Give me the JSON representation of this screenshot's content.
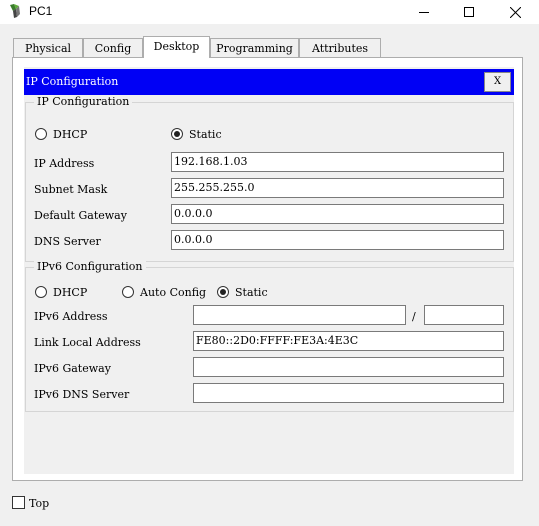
{
  "window": {
    "title": "PC1"
  },
  "tabs": [
    {
      "label": "Physical"
    },
    {
      "label": "Config"
    },
    {
      "label": "Desktop",
      "active": true
    },
    {
      "label": "Programming"
    },
    {
      "label": "Attributes"
    }
  ],
  "ip_config": {
    "header_title": "IP Configuration",
    "close_label": "X",
    "ipv4": {
      "legend": "IP Configuration",
      "dhcp_label": "DHCP",
      "static_label": "Static",
      "selected_mode": "Static",
      "ip_address": {
        "label": "IP Address",
        "value": "192.168.1.03"
      },
      "subnet_mask": {
        "label": "Subnet Mask",
        "value": "255.255.255.0"
      },
      "default_gateway": {
        "label": "Default Gateway",
        "value": "0.0.0.0"
      },
      "dns_server": {
        "label": "DNS Server",
        "value": "0.0.0.0"
      }
    },
    "ipv6": {
      "legend": "IPv6 Configuration",
      "dhcp_label": "DHCP",
      "auto_label": "Auto Config",
      "static_label": "Static",
      "selected_mode": "Static",
      "address": {
        "label": "IPv6 Address",
        "value": "",
        "prefix": "",
        "separator": "/"
      },
      "link_local": {
        "label": "Link Local Address",
        "value": "FE80::2D0:FFFF:FE3A:4E3C"
      },
      "gateway": {
        "label": "IPv6 Gateway",
        "value": ""
      },
      "dns": {
        "label": "IPv6 DNS Server",
        "value": ""
      }
    }
  },
  "footer": {
    "top_label": "Top",
    "top_checked": false
  },
  "colors": {
    "header_blue": "#0000f5",
    "background": "#f0f0f0"
  }
}
